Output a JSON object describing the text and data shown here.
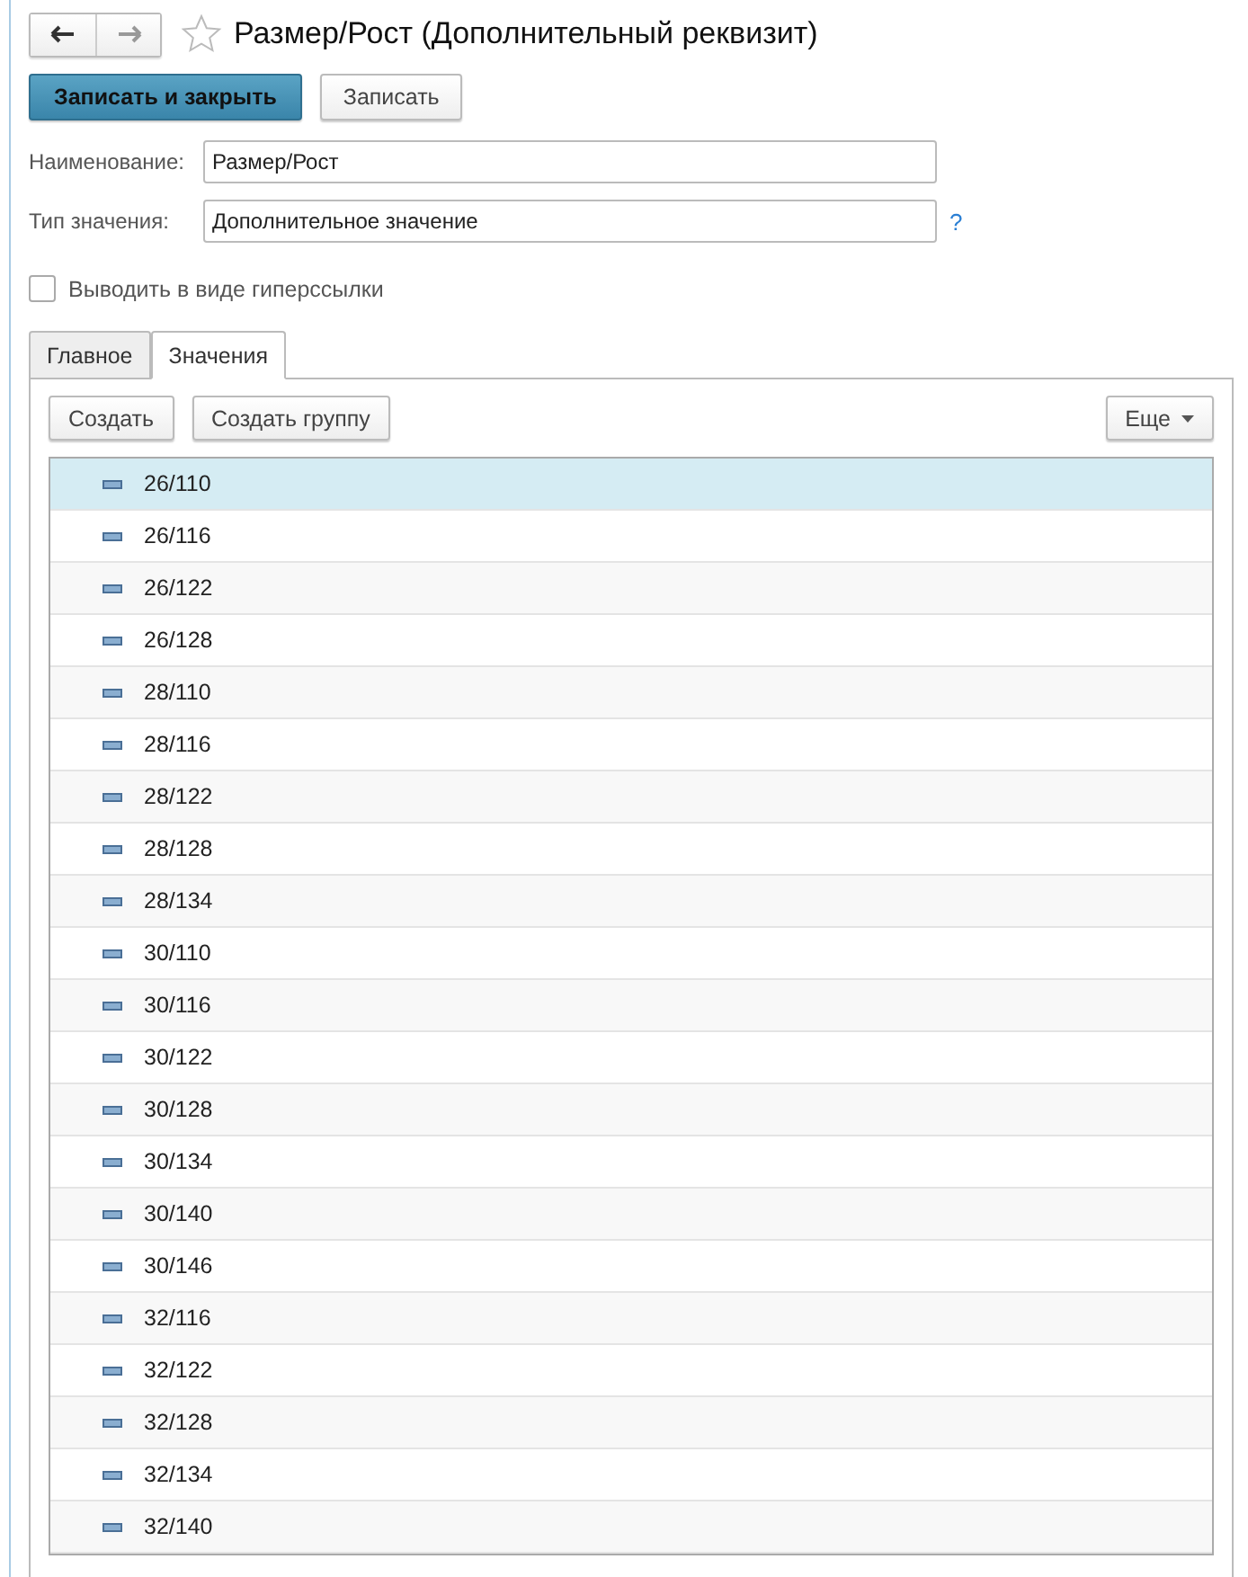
{
  "window": {
    "title": "Размер/Рост (Дополнительный реквизит)",
    "favorite": false
  },
  "actions": [
    {
      "label": "Записать и закрыть",
      "kind": "primary"
    },
    {
      "label": "Записать",
      "kind": "default"
    }
  ],
  "fields": [
    {
      "label": "Наименование:",
      "value": "Размер/Рост"
    },
    {
      "label": "Тип значения:",
      "value": "Дополнительное значение",
      "help": "?"
    }
  ],
  "hyperlink_option": {
    "label": "Выводить в виде гиперссылки",
    "checked": false
  },
  "tabs": [
    {
      "label": "Главное",
      "selected": false
    },
    {
      "label": "Значения",
      "selected": true
    }
  ],
  "toolbar": {
    "buttons": [
      "Создать",
      "Создать группу"
    ],
    "more": "Еще"
  },
  "rows": [
    {
      "value": "26/110",
      "selected": true
    },
    {
      "value": "26/116",
      "selected": false
    },
    {
      "value": "26/122",
      "selected": false
    },
    {
      "value": "26/128",
      "selected": false
    },
    {
      "value": "28/110",
      "selected": false
    },
    {
      "value": "28/116",
      "selected": false
    },
    {
      "value": "28/122",
      "selected": false
    },
    {
      "value": "28/128",
      "selected": false
    },
    {
      "value": "28/134",
      "selected": false
    },
    {
      "value": "30/110",
      "selected": false
    },
    {
      "value": "30/116",
      "selected": false
    },
    {
      "value": "30/122",
      "selected": false
    },
    {
      "value": "30/128",
      "selected": false
    },
    {
      "value": "30/134",
      "selected": false
    },
    {
      "value": "30/140",
      "selected": false
    },
    {
      "value": "30/146",
      "selected": false
    },
    {
      "value": "32/116",
      "selected": false
    },
    {
      "value": "32/122",
      "selected": false
    },
    {
      "value": "32/128",
      "selected": false
    },
    {
      "value": "32/134",
      "selected": false
    },
    {
      "value": "32/140",
      "selected": false
    }
  ]
}
